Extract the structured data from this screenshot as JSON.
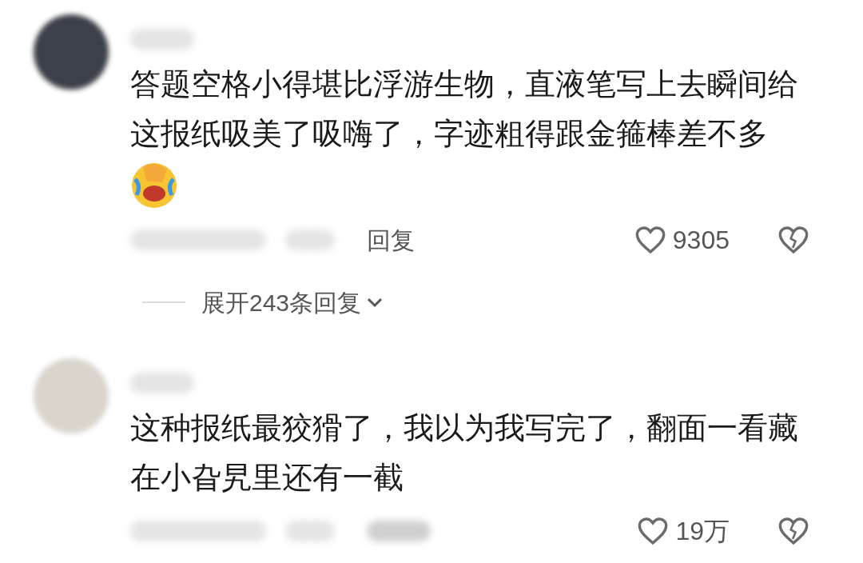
{
  "comments": [
    {
      "text": "答题空格小得堪比浮游生物，直液笔写上去瞬间给这报纸吸美了吸嗨了，字迹粗得跟金箍棒差不多",
      "emoji": true,
      "reply_label": "回复",
      "likes": "9305",
      "expand": "展开243条回复"
    },
    {
      "text": "这种报纸最狡猾了，我以为我写完了，翻面一看藏在小旮旯里还有一截",
      "emoji": false,
      "likes": "19万"
    }
  ]
}
